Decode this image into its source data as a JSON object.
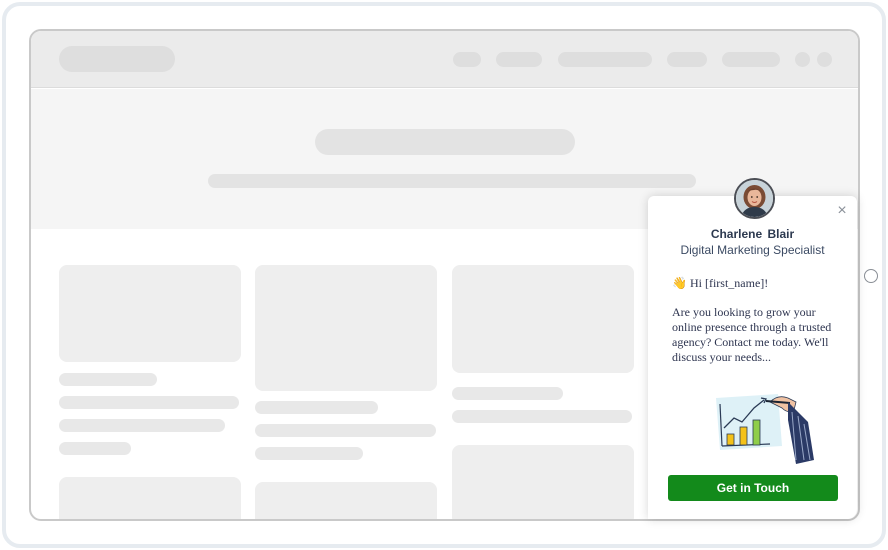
{
  "popup": {
    "agent_name": "Charlene  Blair",
    "agent_role": "Digital Marketing Specialist",
    "greeting_emoji": "👋",
    "greeting_text": "Hi [first_name]!",
    "message": "Are you looking to grow your online presence through a trusted agency? Contact me today. We'll discuss your needs...",
    "close_glyph": "×",
    "cta_label": "Get in Touch",
    "avatar_icon": "agent-avatar",
    "illustration_icon": "growth-chart-illustration"
  },
  "colors": {
    "cta": "#138a1b",
    "placeholder": "#eeeeee",
    "frame": "#e6ebf0"
  }
}
